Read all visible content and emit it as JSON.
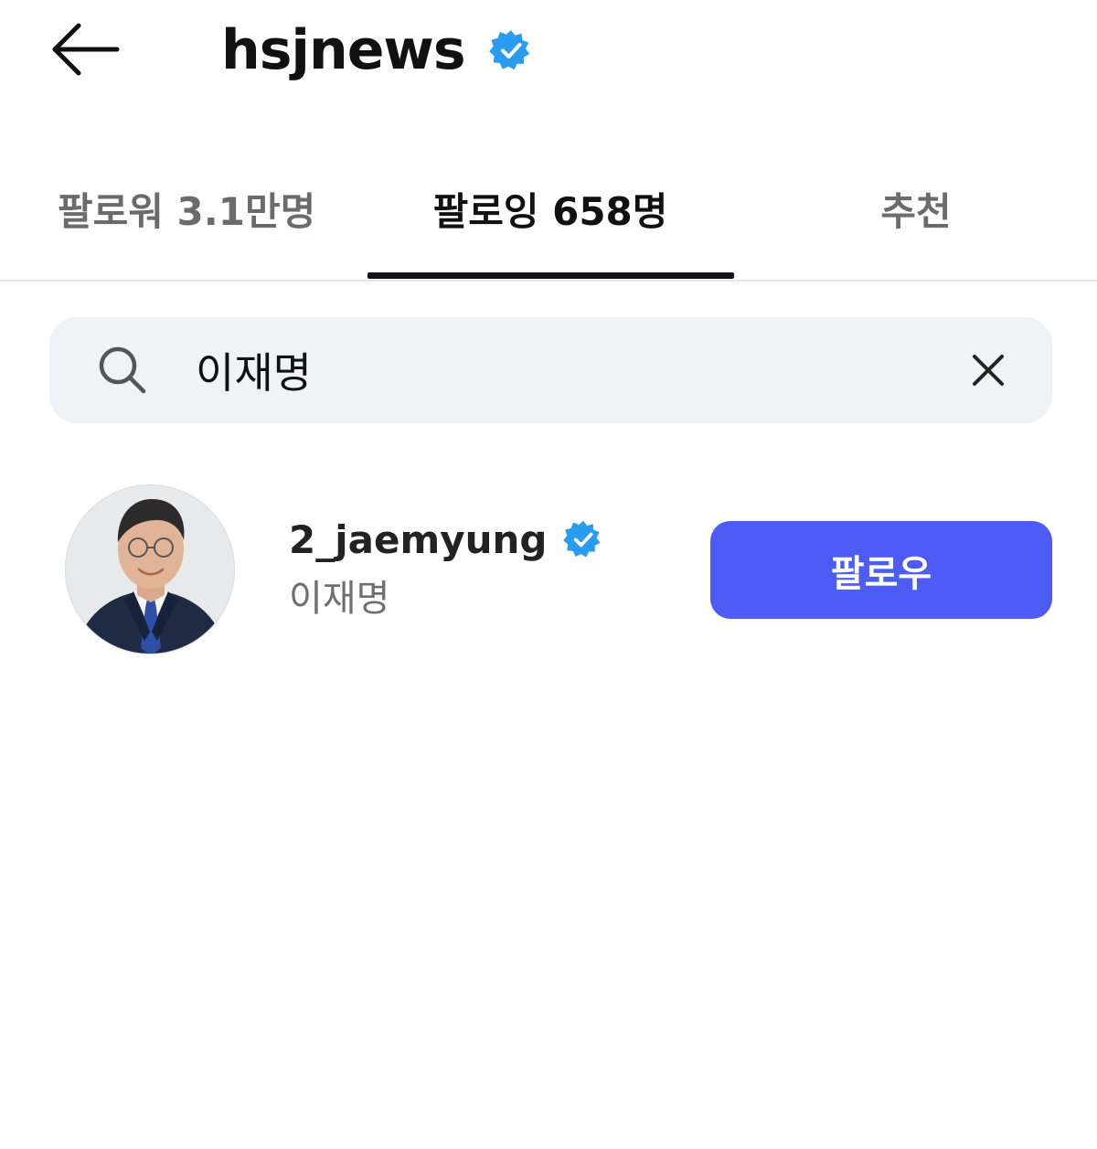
{
  "header": {
    "title": "hsjnews",
    "verified": true,
    "back_icon": "arrow-left-icon"
  },
  "tabs": [
    {
      "label": "팔로워 3.1만명",
      "active": false
    },
    {
      "label": "팔로잉 658명",
      "active": true
    },
    {
      "label": "추천",
      "active": false
    }
  ],
  "search": {
    "value": "이재명",
    "search_icon": "search-icon",
    "clear_icon": "close-icon"
  },
  "results": [
    {
      "username": "2_jaemyung",
      "display_name": "이재명",
      "verified": true,
      "follow_label": "팔로우"
    }
  ],
  "colors": {
    "accent": "#4c5cf5",
    "verified": "#2a9cf0",
    "tab_indicator": "#101318",
    "search_bg": "#f1f2f5"
  }
}
